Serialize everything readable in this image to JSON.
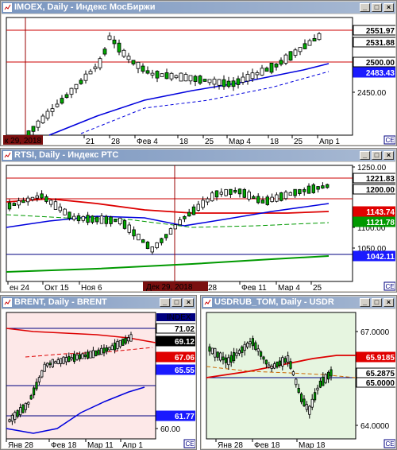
{
  "windows": {
    "imoex": {
      "title": "IMOEX, Daily - Индекс МосБиржи",
      "date_axis": [
        "21",
        "28",
        "Фев 4",
        "18",
        "25",
        "Мар 4",
        "18",
        "25",
        "Апр 1"
      ],
      "cursor_date": "к 29, 2018",
      "price_axis": [
        "2450.00"
      ],
      "price_labels": [
        {
          "text": "2551.97",
          "bg": "#ffffff",
          "fg": "#000000"
        },
        {
          "text": "2531.88",
          "bg": "#ffffff",
          "fg": "#000000"
        },
        {
          "text": "2500.00",
          "bg": "#ffffff",
          "fg": "#000000"
        },
        {
          "text": "2483.43",
          "bg": "#1a1aff",
          "fg": "#ffffff"
        }
      ]
    },
    "rtsi": {
      "title": "RTSI, Daily - Индекс РТС",
      "date_axis": [
        "ен 24",
        "Окт 15",
        "Ноя 6",
        "28",
        "Фев 11",
        "Мар 4",
        "25"
      ],
      "cursor_date": "Дек 29, 2018",
      "price_axis": [
        "1250.00",
        "1100.00",
        "1050.00"
      ],
      "price_labels": [
        {
          "text": "1221.83",
          "bg": "#ffffff",
          "fg": "#000000"
        },
        {
          "text": "1200.00",
          "bg": "#ffffff",
          "fg": "#000000"
        },
        {
          "text": "1143.74",
          "bg": "#e00000",
          "fg": "#ffffff"
        },
        {
          "text": "1121.78",
          "bg": "#009900",
          "fg": "#ffffff"
        },
        {
          "text": "1042.11",
          "bg": "#1a1aff",
          "fg": "#ffffff"
        }
      ]
    },
    "brent": {
      "title": "BRENT, Daily - BRENT",
      "date_axis": [
        "Янв 28",
        "Фев 18",
        "Мар 11",
        "Апр 1"
      ],
      "index_tag": "INDEX",
      "price_axis": [
        "60.00"
      ],
      "price_labels": [
        {
          "text": "71.02",
          "bg": "#ffffff",
          "fg": "#000000"
        },
        {
          "text": "69.12",
          "bg": "#000000",
          "fg": "#ffffff"
        },
        {
          "text": "67.06",
          "bg": "#e00000",
          "fg": "#ffffff"
        },
        {
          "text": "65.55",
          "bg": "#1a1aff",
          "fg": "#ffffff"
        },
        {
          "text": "61.77",
          "bg": "#1a1aff",
          "fg": "#ffffff"
        }
      ]
    },
    "usdrub": {
      "title": "USDRUB_TOM, Daily - USDR",
      "date_axis": [
        "Янв 28",
        "Фев 18",
        "Мар 18"
      ],
      "price_axis": [
        "67.0000",
        "64.0000"
      ],
      "price_labels": [
        {
          "text": "65.9185",
          "bg": "#e00000",
          "fg": "#ffffff"
        },
        {
          "text": "65.2875",
          "bg": "#ffffff",
          "fg": "#000000"
        },
        {
          "text": "65.0000",
          "bg": "#ffffff",
          "fg": "#000000"
        }
      ]
    }
  },
  "buttons": {
    "minimize": "_",
    "maximize": "□",
    "close": "×"
  },
  "colors": {
    "candle_up": "#00aa00",
    "candle_down": "#cc0000",
    "ma_blue": "#0000dd",
    "ma_red": "#dd0000",
    "ma_green": "#009900",
    "brent_bg": "#fde8e8",
    "usdrub_bg": "#e6f5e0"
  }
}
